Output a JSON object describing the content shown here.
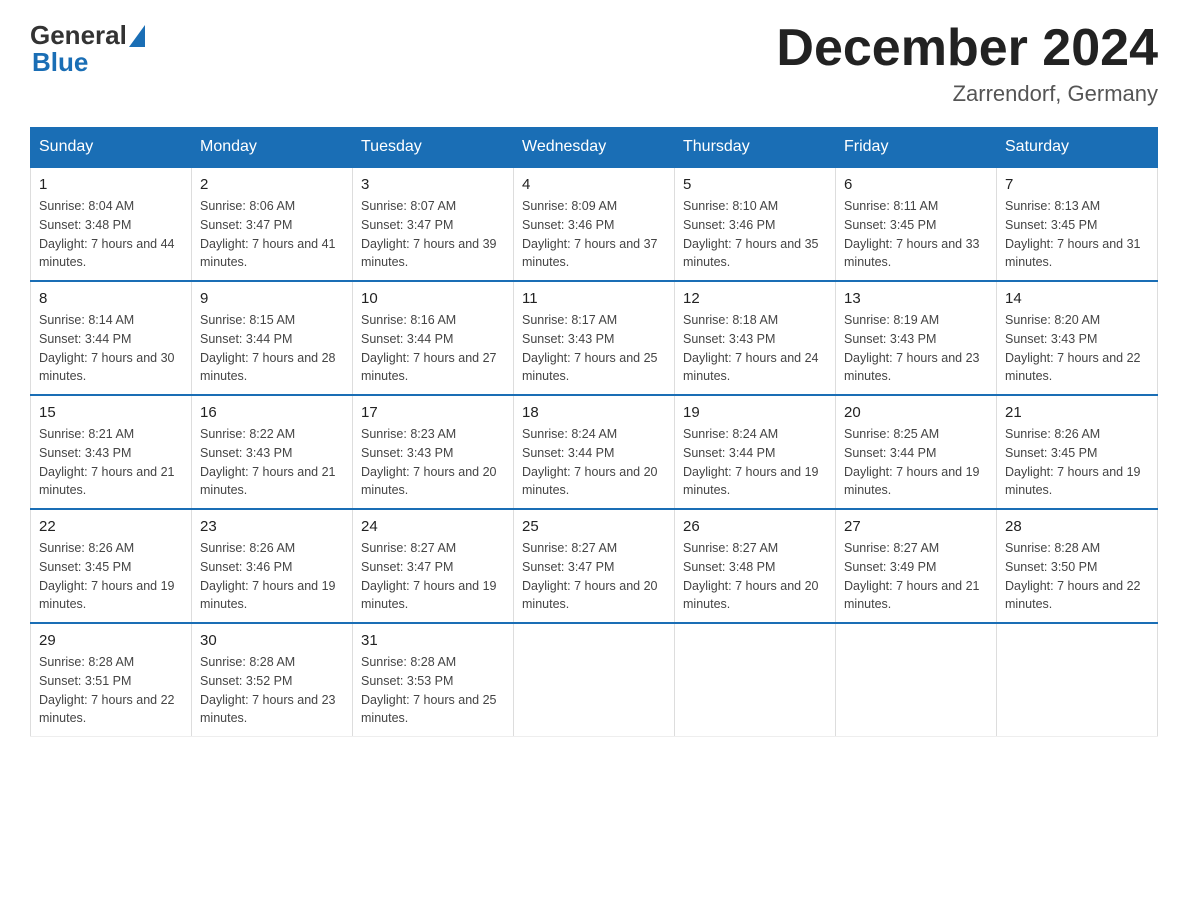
{
  "header": {
    "logo_general": "General",
    "logo_blue": "Blue",
    "title": "December 2024",
    "subtitle": "Zarrendorf, Germany"
  },
  "days_header": [
    "Sunday",
    "Monday",
    "Tuesday",
    "Wednesday",
    "Thursday",
    "Friday",
    "Saturday"
  ],
  "weeks": [
    [
      {
        "day": "1",
        "sunrise": "8:04 AM",
        "sunset": "3:48 PM",
        "daylight": "7 hours and 44 minutes."
      },
      {
        "day": "2",
        "sunrise": "8:06 AM",
        "sunset": "3:47 PM",
        "daylight": "7 hours and 41 minutes."
      },
      {
        "day": "3",
        "sunrise": "8:07 AM",
        "sunset": "3:47 PM",
        "daylight": "7 hours and 39 minutes."
      },
      {
        "day": "4",
        "sunrise": "8:09 AM",
        "sunset": "3:46 PM",
        "daylight": "7 hours and 37 minutes."
      },
      {
        "day": "5",
        "sunrise": "8:10 AM",
        "sunset": "3:46 PM",
        "daylight": "7 hours and 35 minutes."
      },
      {
        "day": "6",
        "sunrise": "8:11 AM",
        "sunset": "3:45 PM",
        "daylight": "7 hours and 33 minutes."
      },
      {
        "day": "7",
        "sunrise": "8:13 AM",
        "sunset": "3:45 PM",
        "daylight": "7 hours and 31 minutes."
      }
    ],
    [
      {
        "day": "8",
        "sunrise": "8:14 AM",
        "sunset": "3:44 PM",
        "daylight": "7 hours and 30 minutes."
      },
      {
        "day": "9",
        "sunrise": "8:15 AM",
        "sunset": "3:44 PM",
        "daylight": "7 hours and 28 minutes."
      },
      {
        "day": "10",
        "sunrise": "8:16 AM",
        "sunset": "3:44 PM",
        "daylight": "7 hours and 27 minutes."
      },
      {
        "day": "11",
        "sunrise": "8:17 AM",
        "sunset": "3:43 PM",
        "daylight": "7 hours and 25 minutes."
      },
      {
        "day": "12",
        "sunrise": "8:18 AM",
        "sunset": "3:43 PM",
        "daylight": "7 hours and 24 minutes."
      },
      {
        "day": "13",
        "sunrise": "8:19 AM",
        "sunset": "3:43 PM",
        "daylight": "7 hours and 23 minutes."
      },
      {
        "day": "14",
        "sunrise": "8:20 AM",
        "sunset": "3:43 PM",
        "daylight": "7 hours and 22 minutes."
      }
    ],
    [
      {
        "day": "15",
        "sunrise": "8:21 AM",
        "sunset": "3:43 PM",
        "daylight": "7 hours and 21 minutes."
      },
      {
        "day": "16",
        "sunrise": "8:22 AM",
        "sunset": "3:43 PM",
        "daylight": "7 hours and 21 minutes."
      },
      {
        "day": "17",
        "sunrise": "8:23 AM",
        "sunset": "3:43 PM",
        "daylight": "7 hours and 20 minutes."
      },
      {
        "day": "18",
        "sunrise": "8:24 AM",
        "sunset": "3:44 PM",
        "daylight": "7 hours and 20 minutes."
      },
      {
        "day": "19",
        "sunrise": "8:24 AM",
        "sunset": "3:44 PM",
        "daylight": "7 hours and 19 minutes."
      },
      {
        "day": "20",
        "sunrise": "8:25 AM",
        "sunset": "3:44 PM",
        "daylight": "7 hours and 19 minutes."
      },
      {
        "day": "21",
        "sunrise": "8:26 AM",
        "sunset": "3:45 PM",
        "daylight": "7 hours and 19 minutes."
      }
    ],
    [
      {
        "day": "22",
        "sunrise": "8:26 AM",
        "sunset": "3:45 PM",
        "daylight": "7 hours and 19 minutes."
      },
      {
        "day": "23",
        "sunrise": "8:26 AM",
        "sunset": "3:46 PM",
        "daylight": "7 hours and 19 minutes."
      },
      {
        "day": "24",
        "sunrise": "8:27 AM",
        "sunset": "3:47 PM",
        "daylight": "7 hours and 19 minutes."
      },
      {
        "day": "25",
        "sunrise": "8:27 AM",
        "sunset": "3:47 PM",
        "daylight": "7 hours and 20 minutes."
      },
      {
        "day": "26",
        "sunrise": "8:27 AM",
        "sunset": "3:48 PM",
        "daylight": "7 hours and 20 minutes."
      },
      {
        "day": "27",
        "sunrise": "8:27 AM",
        "sunset": "3:49 PM",
        "daylight": "7 hours and 21 minutes."
      },
      {
        "day": "28",
        "sunrise": "8:28 AM",
        "sunset": "3:50 PM",
        "daylight": "7 hours and 22 minutes."
      }
    ],
    [
      {
        "day": "29",
        "sunrise": "8:28 AM",
        "sunset": "3:51 PM",
        "daylight": "7 hours and 22 minutes."
      },
      {
        "day": "30",
        "sunrise": "8:28 AM",
        "sunset": "3:52 PM",
        "daylight": "7 hours and 23 minutes."
      },
      {
        "day": "31",
        "sunrise": "8:28 AM",
        "sunset": "3:53 PM",
        "daylight": "7 hours and 25 minutes."
      },
      null,
      null,
      null,
      null
    ]
  ]
}
